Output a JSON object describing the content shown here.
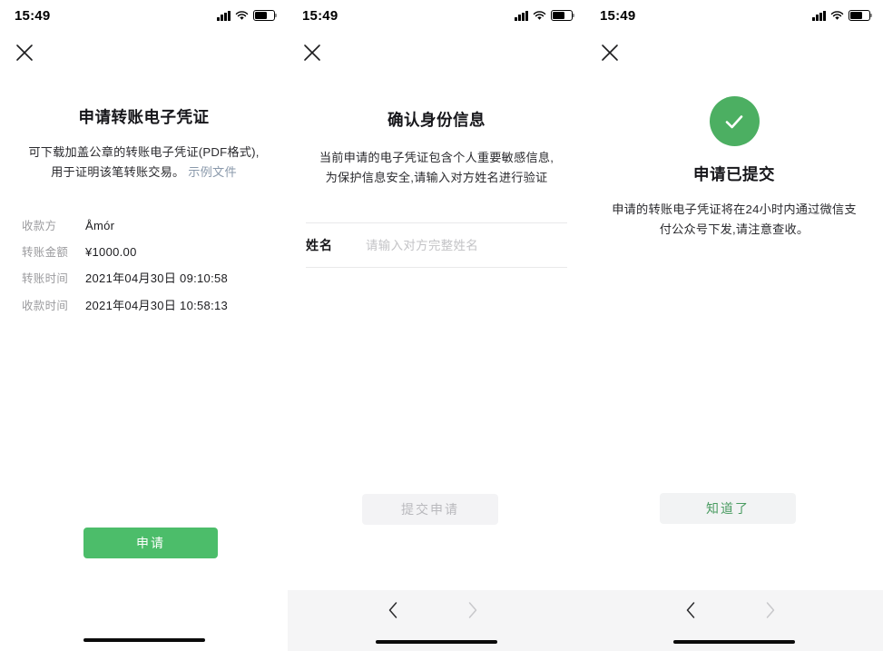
{
  "status_bar": {
    "time": "15:49",
    "icons": [
      "signal-icon",
      "wifi-icon",
      "battery-icon"
    ]
  },
  "colors": {
    "accent_green": "#4CBD6A",
    "success_green": "#4CAF62",
    "ghost_text_green": "#4b9c62",
    "link_gray": "#8a99ab",
    "label_gray": "#9b9b9e",
    "disabled_bg": "#f3f3f5",
    "disabled_text": "#b9b9bd",
    "nav_bar_bg": "#f5f5f6"
  },
  "screen1": {
    "close_label": "close-icon",
    "title": "申请转账电子凭证",
    "subtitle_line1": "可下载加盖公章的转账电子凭证(PDF格式),",
    "subtitle_line2": "用于证明该笔转账交易。",
    "sample_link": "示例文件",
    "info_rows": [
      {
        "label": "收款方",
        "value": "Åmór"
      },
      {
        "label": "转账金额",
        "value": "¥1000.00"
      },
      {
        "label": "转账时间",
        "value": "2021年04月30日 09:10:58"
      },
      {
        "label": "收款时间",
        "value": "2021年04月30日 10:58:13"
      }
    ],
    "primary_button": "申请"
  },
  "screen2": {
    "close_label": "close-icon",
    "title": "确认身份信息",
    "subtitle_line1": "当前申请的电子凭证包含个人重要敏感信息,",
    "subtitle_line2": "为保护信息安全,请输入对方姓名进行验证",
    "form": {
      "name_label": "姓名",
      "name_value": "",
      "name_placeholder": "请输入对方完整姓名"
    },
    "submit_button": "提交申请",
    "submit_disabled": true,
    "nav": {
      "back": "‹",
      "forward": "›",
      "back_enabled": true,
      "forward_enabled": false
    }
  },
  "screen3": {
    "close_label": "close-icon",
    "success_icon": "check-circle-icon",
    "title": "申请已提交",
    "subtitle_line1": "申请的转账电子凭证将在24小时内通过微信支",
    "subtitle_line2": "付公众号下发,请注意查收。",
    "confirm_button": "知道了",
    "nav": {
      "back": "‹",
      "forward": "›",
      "back_enabled": true,
      "forward_enabled": false
    }
  }
}
